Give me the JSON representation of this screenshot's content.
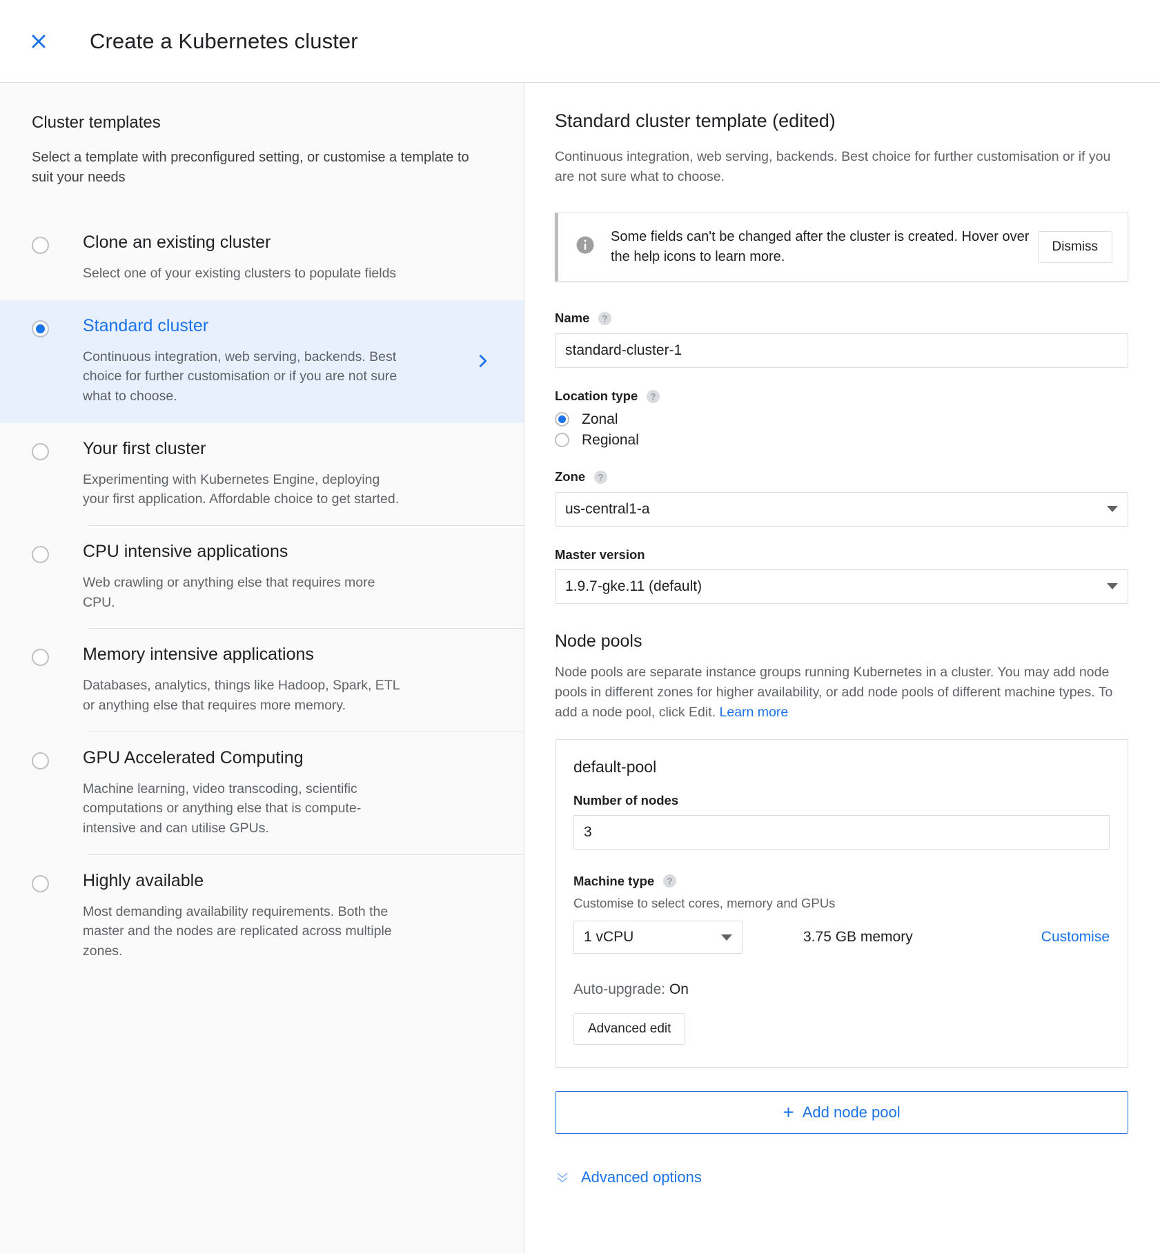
{
  "header": {
    "close_icon": "close-icon",
    "title": "Create a Kubernetes cluster"
  },
  "sidebar": {
    "title": "Cluster templates",
    "subtitle": "Select a template with preconfigured setting, or customise a template to suit your needs",
    "templates": [
      {
        "name": "Clone an existing cluster",
        "description": "Select one of your existing clusters to populate fields",
        "selected": false
      },
      {
        "name": "Standard cluster",
        "description": "Continuous integration, web serving, backends. Best choice for further customisation or if you are not sure what to choose.",
        "selected": true
      },
      {
        "name": "Your first cluster",
        "description": "Experimenting with Kubernetes Engine, deploying your first application. Affordable choice to get started.",
        "selected": false
      },
      {
        "name": "CPU intensive applications",
        "description": "Web crawling or anything else that requires more CPU.",
        "selected": false
      },
      {
        "name": "Memory intensive applications",
        "description": "Databases, analytics, things like Hadoop, Spark, ETL or anything else that requires more memory.",
        "selected": false
      },
      {
        "name": "GPU Accelerated Computing",
        "description": "Machine learning, video transcoding, scientific computations or anything else that is compute-intensive and can utilise GPUs.",
        "selected": false
      },
      {
        "name": "Highly available",
        "description": "Most demanding availability requirements. Both the master and the nodes are replicated across multiple zones.",
        "selected": false
      }
    ]
  },
  "main": {
    "title": "Standard cluster template (edited)",
    "subtitle": "Continuous integration, web serving, backends. Best choice for further customisation or if you are not sure what to choose.",
    "info_banner": {
      "icon": "info-icon",
      "text": "Some fields can't be changed after the cluster is created. Hover over the help icons to learn more.",
      "dismiss_label": "Dismiss"
    },
    "name_field": {
      "label": "Name",
      "value": "standard-cluster-1",
      "placeholder": ""
    },
    "location_type": {
      "label": "Location type",
      "options": [
        "Zonal",
        "Regional"
      ],
      "selected": "Zonal"
    },
    "zone_field": {
      "label": "Zone",
      "value": "us-central1-a"
    },
    "master_version": {
      "label": "Master version",
      "value": "1.9.7-gke.11 (default)"
    },
    "node_pools": {
      "title": "Node pools",
      "description_1": "Node pools are separate instance groups running Kubernetes in a cluster. You may add node pools in different zones for higher availability, or add node pools of different machine types. To add a node pool, click Edit. ",
      "learn_more": "Learn more",
      "pool": {
        "name": "default-pool",
        "nodes_label": "Number of nodes",
        "nodes_value": "3",
        "machine_type_label": "Machine type",
        "machine_type_hint": "Customise to select cores, memory and GPUs",
        "machine_type_value": "1 vCPU",
        "memory": "3.75 GB memory",
        "customise_label": "Customise",
        "auto_upgrade_label": "Auto-upgrade: ",
        "auto_upgrade_value": "On",
        "advanced_edit_label": "Advanced edit"
      },
      "add_pool_label": "Add node pool",
      "add_pool_plus": "+"
    },
    "advanced_options_label": "Advanced options"
  },
  "colors": {
    "accent": "#1a73e8",
    "selected_row_bg": "#e8f0fe",
    "sidebar_bg": "#fafafa",
    "border": "#dadce0",
    "muted_text": "#5f6368"
  }
}
